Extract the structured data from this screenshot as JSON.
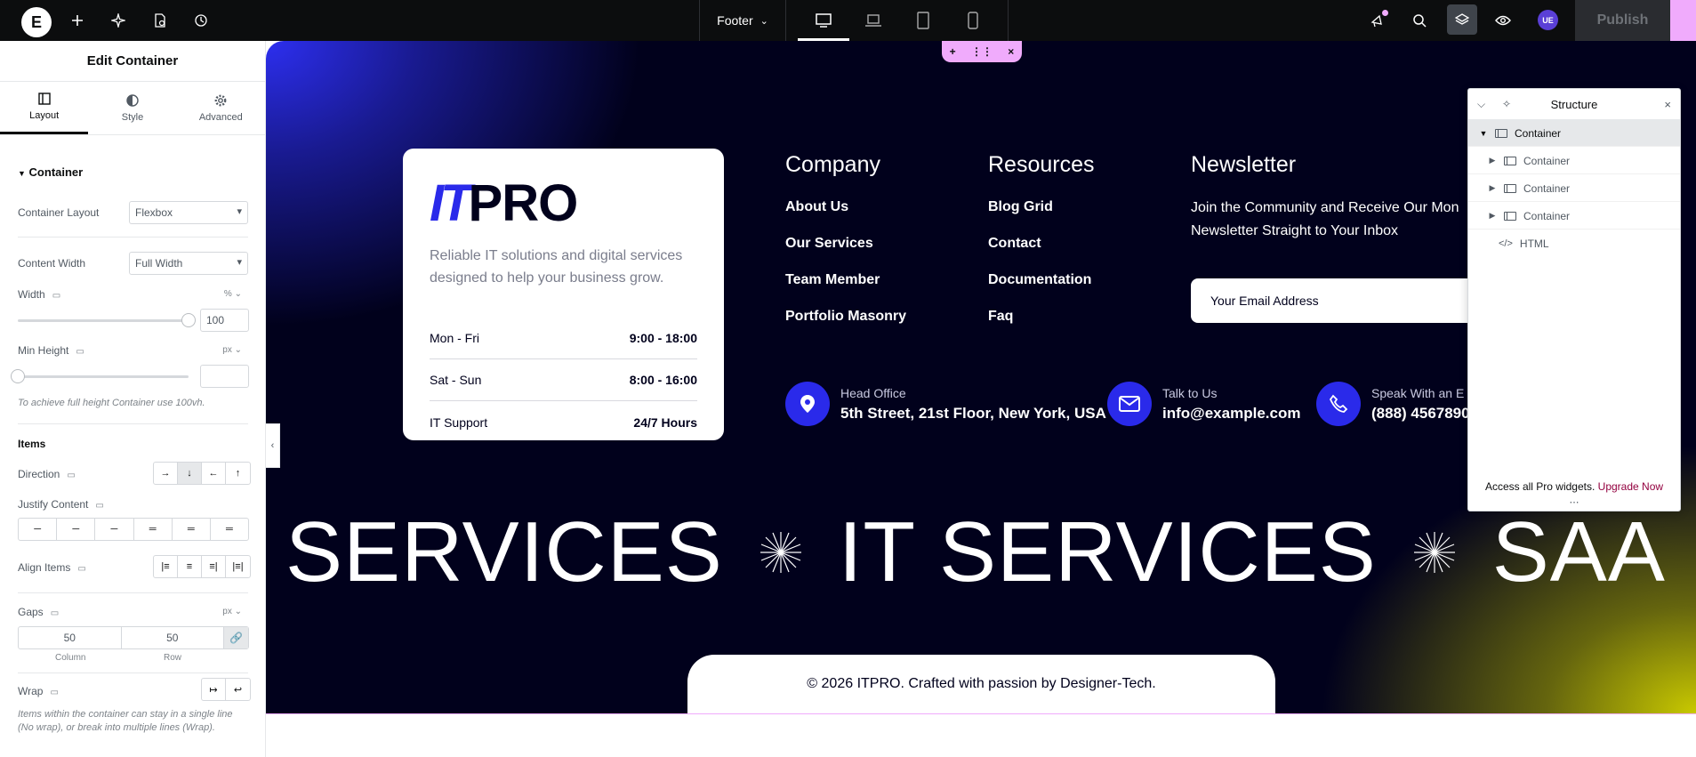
{
  "topbar": {
    "document_name": "Footer",
    "publish_label": "Publish",
    "avatar_initials": "UE"
  },
  "panel": {
    "title": "Edit Container",
    "tabs": [
      {
        "label": "Layout",
        "icon": "layout-icon"
      },
      {
        "label": "Style",
        "icon": "contrast-icon"
      },
      {
        "label": "Advanced",
        "icon": "gear-icon"
      }
    ],
    "section": "Container",
    "container_layout": {
      "label": "Container Layout",
      "value": "Flexbox"
    },
    "content_width": {
      "label": "Content Width",
      "value": "Full Width"
    },
    "width": {
      "label": "Width",
      "unit": "%",
      "value": "100"
    },
    "min_height": {
      "label": "Min Height",
      "unit": "px",
      "value": "",
      "hint": "To achieve full height Container use 100vh."
    },
    "items_heading": "Items",
    "direction_label": "Direction",
    "justify_label": "Justify Content",
    "align_label": "Align Items",
    "gaps": {
      "label": "Gaps",
      "unit": "px",
      "column": "50",
      "row": "50",
      "column_label": "Column",
      "row_label": "Row"
    },
    "wrap": {
      "label": "Wrap",
      "hint": "Items within the container can stay in a single line (No wrap), or break into multiple lines (Wrap)."
    }
  },
  "footer": {
    "logo_mark": "IT",
    "logo_text": "PRO",
    "description": "Reliable IT solutions and digital services designed to help your business grow.",
    "hours": [
      {
        "day": "Mon - Fri",
        "time": "9:00 - 18:00"
      },
      {
        "day": "Sat - Sun",
        "time": "8:00 - 16:00"
      },
      {
        "day": "IT Support",
        "time": "24/7 Hours"
      }
    ],
    "company": {
      "title": "Company",
      "links": [
        "About Us",
        "Our Services",
        "Team Member",
        "Portfolio Masonry"
      ]
    },
    "resources": {
      "title": "Resources",
      "links": [
        "Blog Grid",
        "Contact",
        "Documentation",
        "Faq"
      ]
    },
    "newsletter": {
      "title": "Newsletter",
      "line1": "Join the Community and Receive Our Mon",
      "line2": "Newsletter Straight to Your Inbox",
      "placeholder": "Your Email Address"
    },
    "contacts": [
      {
        "label": "Head Office",
        "value": "5th Street, 21st Floor, New York, USA",
        "icon": "map-pin-icon"
      },
      {
        "label": "Talk to Us",
        "value": "info@example.com",
        "icon": "envelope-icon"
      },
      {
        "label": "Speak With an E",
        "value": "(888) 4567890",
        "icon": "phone-icon"
      }
    ],
    "marquee": [
      "SERVICES",
      "IT SERVICES",
      "SAA"
    ],
    "copyright": "© 2026 ITPRO. Crafted with passion by Designer-Tech."
  },
  "structure": {
    "title": "Structure",
    "rows": [
      {
        "label": "Container",
        "level": 0,
        "expanded": true,
        "selected": true
      },
      {
        "label": "Container",
        "level": 1,
        "expanded": false,
        "selected": false
      },
      {
        "label": "Container",
        "level": 1,
        "expanded": false,
        "selected": false
      },
      {
        "label": "Container",
        "level": 1,
        "expanded": false,
        "selected": false
      },
      {
        "label": "HTML",
        "level": 1,
        "expanded": false,
        "selected": false
      }
    ],
    "footer_text": "Access all Pro widgets.",
    "upgrade_label": "Upgrade Now"
  }
}
